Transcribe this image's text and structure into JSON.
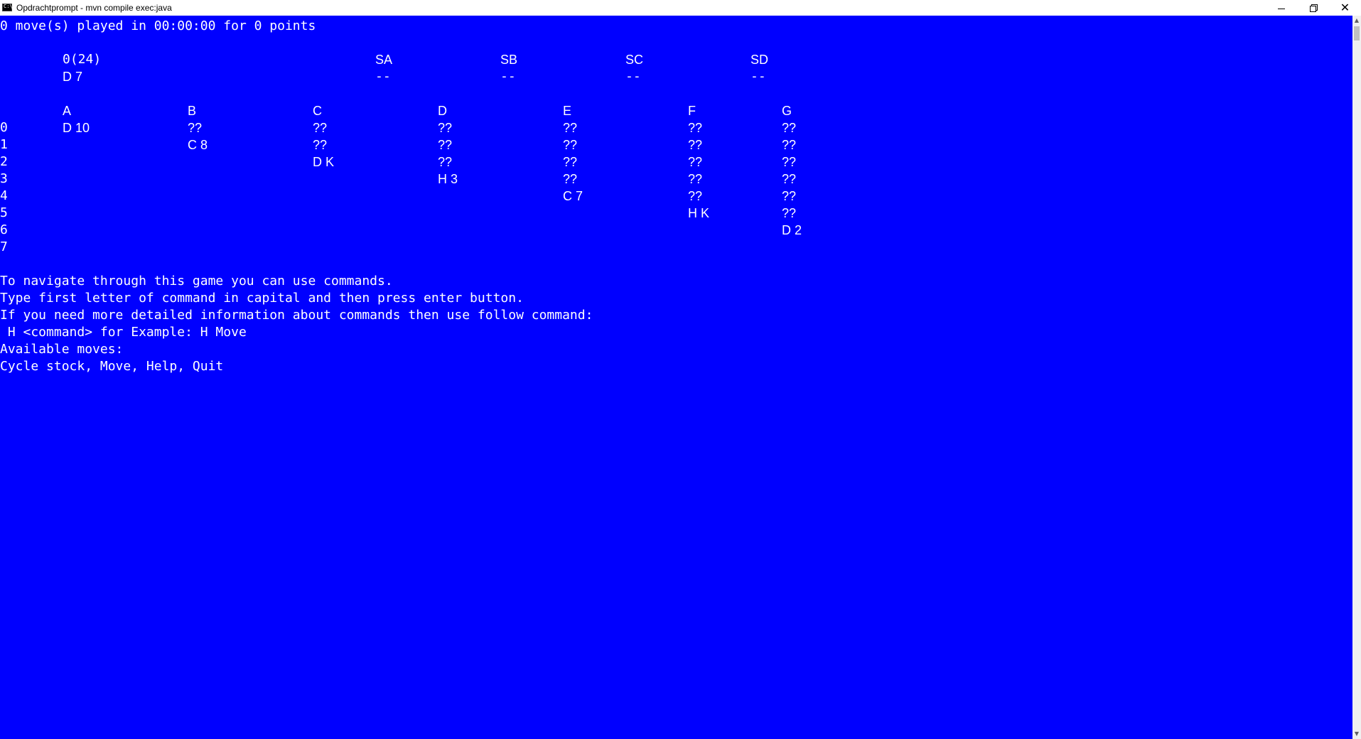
{
  "window": {
    "title": "Opdrachtprompt - mvn  compile exec:java",
    "controls": {
      "minimize": "minimize-icon",
      "restore": "restore-icon",
      "close": "close-icon"
    },
    "background_color": "#0000FF",
    "text_color": "#FFFFFF"
  },
  "status_line": "0 move(s) played in 00:00:00 for 0 points",
  "stock": {
    "label": "0(24)",
    "card": "D 7"
  },
  "foundations": [
    {
      "label": "SA",
      "value": "--"
    },
    {
      "label": "SB",
      "value": "--"
    },
    {
      "label": "SC",
      "value": "--"
    },
    {
      "label": "SD",
      "value": "--"
    }
  ],
  "tableau": {
    "columns": [
      "A",
      "B",
      "C",
      "D",
      "E",
      "F",
      "G"
    ],
    "row_labels": [
      "0",
      "1",
      "2",
      "3",
      "4",
      "5",
      "6",
      "7"
    ],
    "piles": [
      [
        "D 10"
      ],
      [
        "??",
        "C 8"
      ],
      [
        "??",
        "??",
        "D K"
      ],
      [
        "??",
        "??",
        "??",
        "H 3"
      ],
      [
        "??",
        "??",
        "??",
        "??",
        "C 7"
      ],
      [
        "??",
        "??",
        "??",
        "??",
        "??",
        "H K"
      ],
      [
        "??",
        "??",
        "??",
        "??",
        "??",
        "??",
        "D 2"
      ]
    ]
  },
  "help_text": {
    "line1": "To navigate through this game you can use commands.",
    "line2": "Type first letter of command in capital and then press enter button.",
    "line3": "If you need more detailed information about commands then use follow command:",
    "line4": " H <command> for Example: H Move",
    "line5": "Available moves:",
    "line6": "Cycle stock, Move, Help, Quit"
  }
}
